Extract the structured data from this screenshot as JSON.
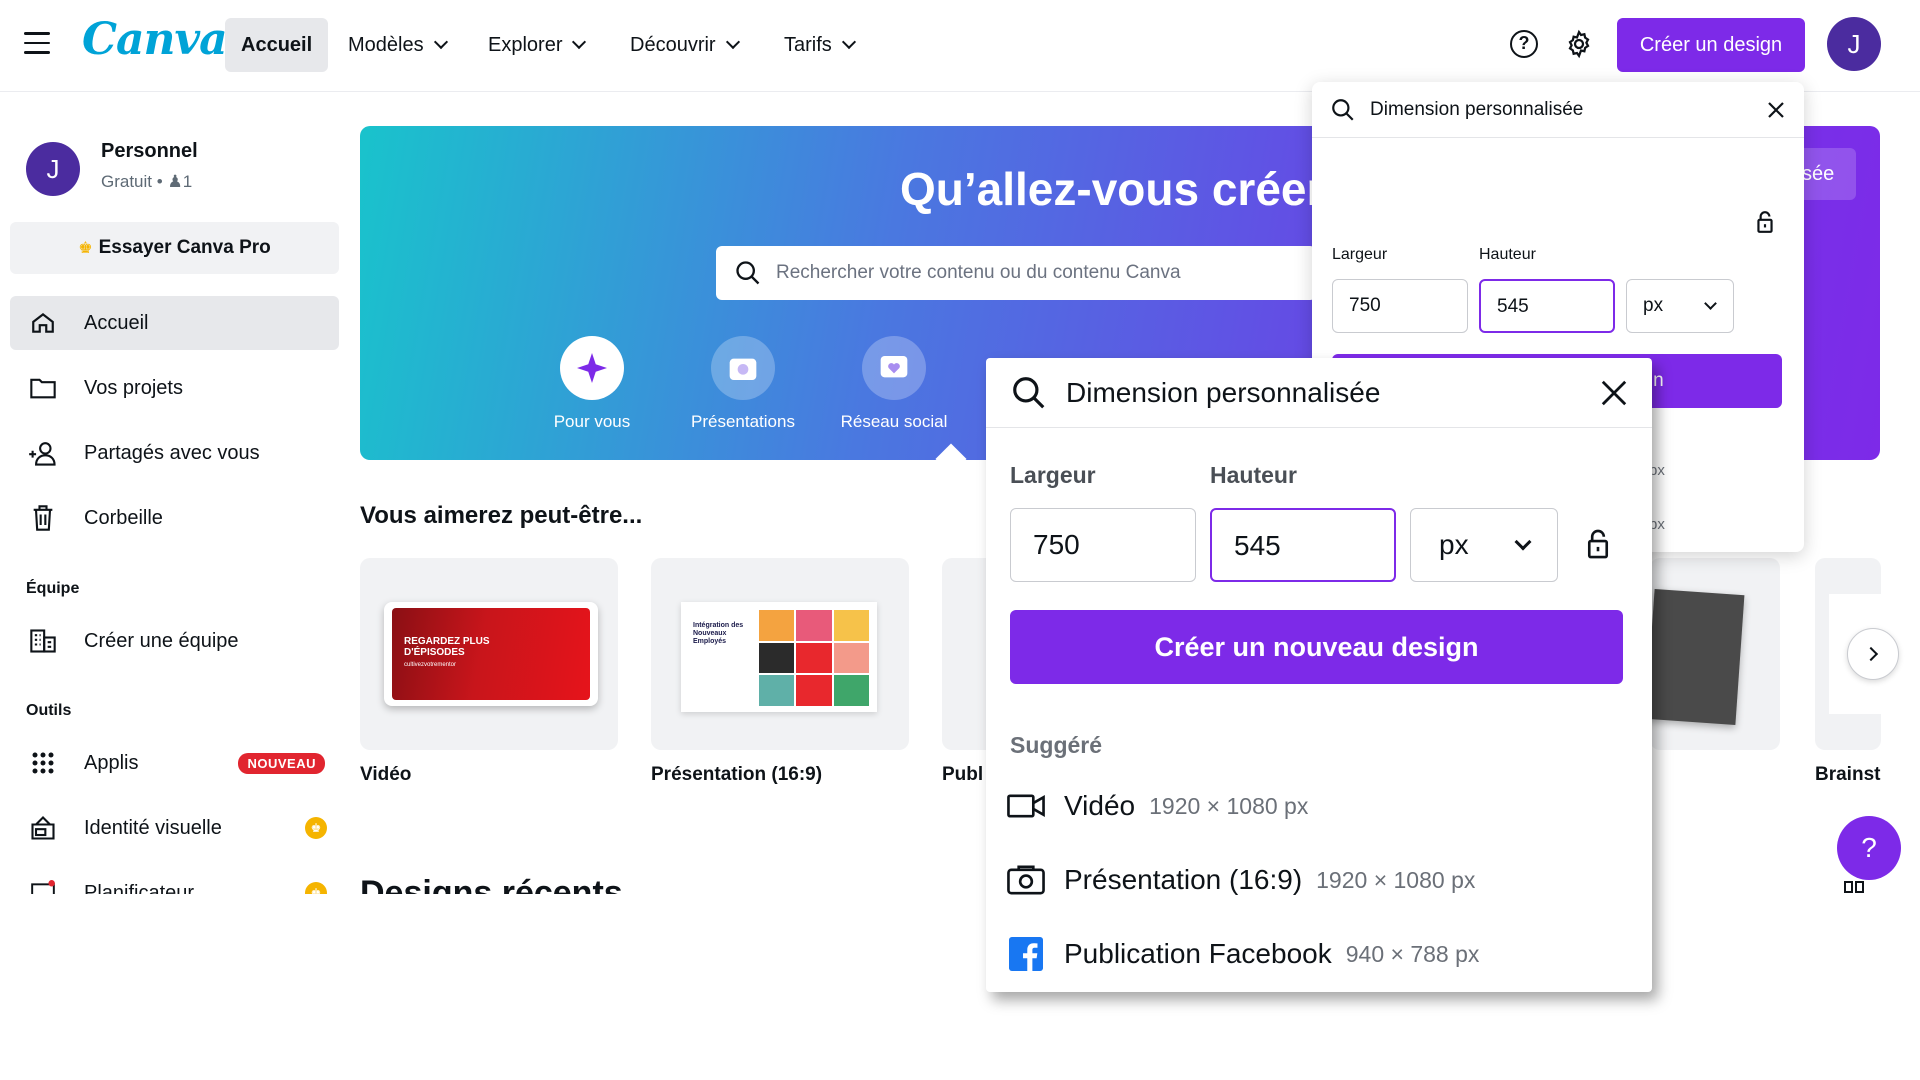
{
  "topbar": {
    "logo": "Canva",
    "nav": [
      "Accueil",
      "Modèles",
      "Explorer",
      "Découvrir",
      "Tarifs"
    ],
    "create_label": "Créer un design",
    "avatar_initial": "J"
  },
  "sidebar": {
    "profile": {
      "initial": "J",
      "name": "Personnel",
      "plan": "Gratuit",
      "members": "1"
    },
    "try_pro": "Essayer Canva Pro",
    "items": [
      "Accueil",
      "Vos projets",
      "Partagés avec vous",
      "Corbeille"
    ],
    "team_section": "Équipe",
    "team_item": "Créer une équipe",
    "tools_section": "Outils",
    "tools": [
      "Applis",
      "Identité visuelle",
      "Planificateur"
    ],
    "new_badge": "NOUVEAU"
  },
  "hero": {
    "title": "Qu’allez-vous créer",
    "search_placeholder": "Rechercher votre contenu ou du contenu Canva",
    "categories": [
      "Pour vous",
      "Présentations",
      "Réseau social"
    ]
  },
  "suggestions": {
    "title": "Vous aimerez peut-être...",
    "cards": [
      "Vidéo",
      "Présentation (16:9)",
      "Publ",
      "Brainst"
    ],
    "thumb_video_text": "REGARDEZ PLUS D'ÉPISODES",
    "thumb_video_sub": "cultivezvotrementor",
    "thumb_pres_text": "Intégration des Nouveaux Employés"
  },
  "recent_title": "Designs récents",
  "custom_size": {
    "title": "Dimension personnalisée",
    "width_label": "Largeur",
    "height_label": "Hauteur",
    "width_value": "750",
    "height_value": "545",
    "unit": "px",
    "cta": "Créer un nouveau design",
    "suggested_label": "Suggéré",
    "suggested": [
      {
        "name": "Vidéo",
        "dims": "1920 × 1080 px"
      },
      {
        "name": "Présentation (16:9)",
        "dims": "1920 × 1080 px"
      },
      {
        "name": "Publication Facebook",
        "dims": "940 × 788 px"
      }
    ]
  },
  "hero_button_fragment": "sée",
  "help_fab": "?",
  "colors": {
    "accent": "#7d2ae8",
    "avatar": "#4b2c9f",
    "badge_red": "#e1252f",
    "crown": "#f5b400"
  }
}
